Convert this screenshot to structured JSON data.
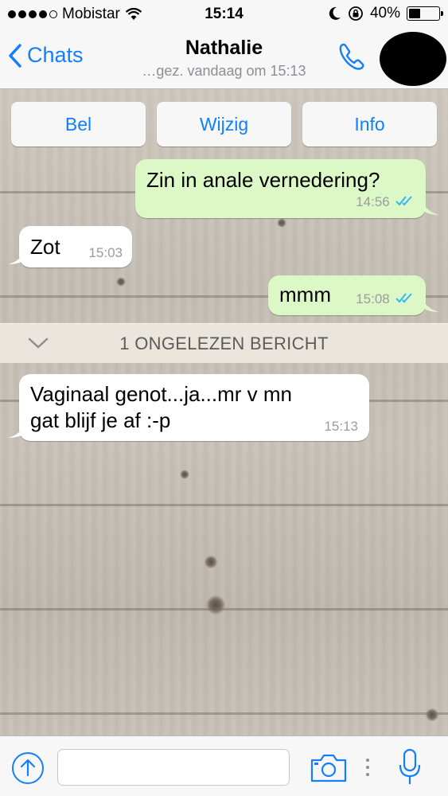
{
  "status_bar": {
    "carrier": "Mobistar",
    "time": "15:14",
    "battery": "40%",
    "battery_level": 0.4,
    "signal_bars_filled": 4,
    "signal_bars_total": 5
  },
  "nav": {
    "back_label": "Chats",
    "contact_name": "Nathalie",
    "last_seen": "…gez. vandaag om 15:13"
  },
  "actions": {
    "call": "Bel",
    "edit": "Wijzig",
    "info": "Info"
  },
  "messages": [
    {
      "direction": "out",
      "text": "Zin in anale vernedering?",
      "time": "14:56",
      "read": true
    },
    {
      "direction": "in",
      "text": "Zot",
      "time": "15:03"
    },
    {
      "direction": "out",
      "text": "mmm",
      "time": "15:08",
      "read": true
    },
    {
      "direction": "in",
      "text_line1": "Vaginaal genot...ja...mr v mn",
      "text_line2": "gat blijf je af :-p",
      "time": "15:13"
    }
  ],
  "unread_banner": "1 ONGELEZEN BERICHT",
  "input": {
    "placeholder": ""
  },
  "colors": {
    "accent": "#127ffb",
    "outgoing_bubble": "#dcf8c6",
    "incoming_bubble": "#ffffff",
    "read_ticks": "#34b7f1"
  },
  "icons": [
    "wifi-icon",
    "moon-icon",
    "rotation-lock-icon",
    "battery-icon",
    "back-chevron-icon",
    "phone-icon",
    "double-check-icon",
    "chevron-down-icon",
    "upload-icon",
    "camera-icon",
    "microphone-icon"
  ]
}
